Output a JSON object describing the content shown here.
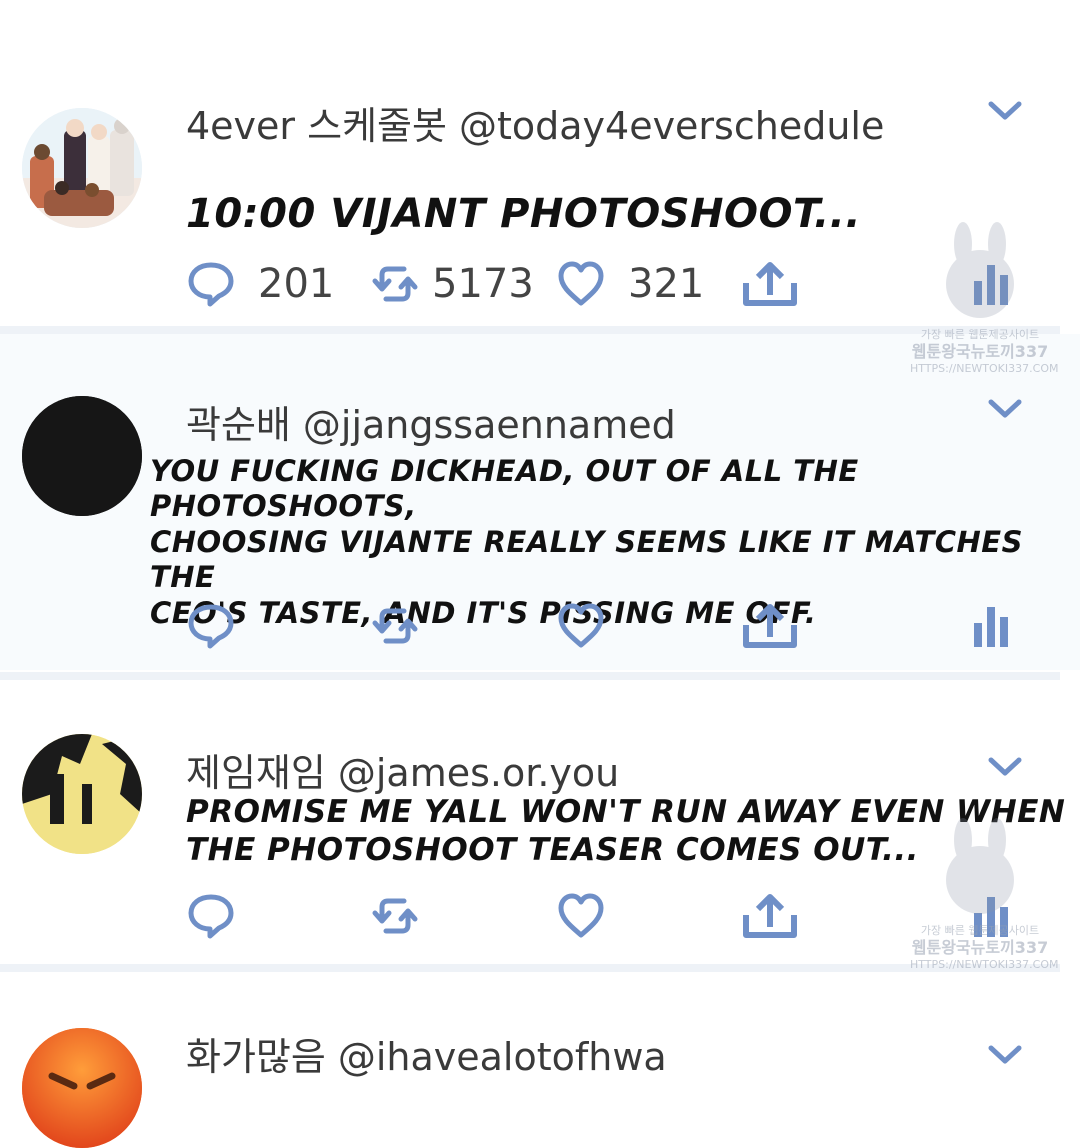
{
  "colors": {
    "icon_blue": "#6f8fc7",
    "divider": "#eef2f7",
    "text_dark": "#111111",
    "text_name": "#3a3a3a"
  },
  "tweets": [
    {
      "display_name": "4ever 스케줄봇",
      "handle": "@today4everschedule",
      "text": "10:00 VIJANT PHOTOSHOOT...",
      "replies": "201",
      "retweets": "5173",
      "likes": "321",
      "avatar": "group-illustration-avatar"
    },
    {
      "display_name": "곽순배",
      "handle": "@jjangssaennamed",
      "text_lines": [
        "YOU FUCKING DICKHEAD, OUT OF ALL THE PHOTOSHOOTS,",
        "CHOOSING VIJANTE REALLY SEEMS LIKE IT MATCHES THE",
        "CEO'S TASTE, AND IT'S PISSING ME OFF."
      ],
      "avatar": "black-circle-avatar"
    },
    {
      "display_name": "제임재임",
      "handle": "@james.or.you",
      "text_lines": [
        "PROMISE ME YALL WON'T RUN AWAY EVEN WHEN",
        "THE PHOTOSHOOT TEASER COMES OUT..."
      ],
      "avatar": "yellow-black-avatar"
    },
    {
      "display_name": "화가많음",
      "handle": "@ihavealotofhwa",
      "avatar": "angry-emoji-avatar"
    }
  ],
  "watermark": {
    "line1": "가장 빠른 웹툰제공사이트",
    "line2": "웹툰왕국뉴토끼337",
    "line3": "HTTPS://NEWTOKI337.COM"
  }
}
